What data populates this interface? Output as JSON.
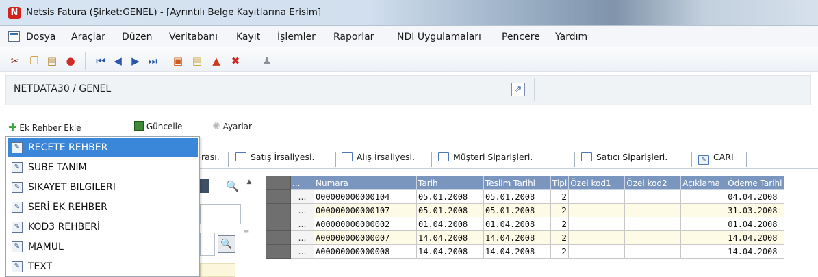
{
  "window": {
    "title": "Netsis Fatura (Şirket:GENEL) - [Ayrıntılı Belge Kayıtlarına Erisim]",
    "logo_letter": "N"
  },
  "menu": {
    "items": [
      "Dosya",
      "Araçlar",
      "Düzen",
      "Veritabanı",
      "Kayıt",
      "İşlemler",
      "Raporlar",
      "NDI Uygulamaları",
      "Pencere",
      "Yardım"
    ]
  },
  "toolbar": {
    "icons": [
      "cut-icon",
      "copy-icon",
      "paste-icon",
      "delete-icon",
      "first-record-icon",
      "prev-record-icon",
      "next-record-icon",
      "last-record-icon",
      "add-record-icon",
      "edit-record-icon",
      "refresh-record-icon",
      "remove-record-icon",
      "user-icon"
    ]
  },
  "path": {
    "text": "NETDATA30 / GENEL"
  },
  "toolbar2": {
    "add_label": "Ek Rehber Ekle",
    "update_label": "Güncelle",
    "settings_label": "Ayarlar"
  },
  "dropdown": {
    "items": [
      "RECETE REHBER",
      "SUBE TANIM",
      "SIKAYET BILGILERI",
      "SERİ EK REHBER",
      "KOD3 REHBERİ",
      "MAMUL",
      "TEXT"
    ],
    "selected_index": 0
  },
  "tabs": {
    "partial_label": "rası.",
    "items": [
      "Satış İrsaliyesi.",
      "Alış İrsaliyesi.",
      "Müşteri Siparişleri.",
      "Satıcı Siparişleri.",
      "CARI"
    ]
  },
  "grid": {
    "columns": [
      "...",
      "Numara",
      "Tarih",
      "Teslim Tarihi",
      "Tipi",
      "Özel kod1",
      "Özel kod2",
      "Açıklama",
      "Ödeme Tarihi"
    ],
    "rows": [
      {
        "dots": "...",
        "numara": "000000000000104",
        "tarih": "05.01.2008",
        "teslim": "05.01.2008",
        "tipi": "2",
        "ozel1": "",
        "ozel2": "",
        "aciklama": "",
        "odeme": "04.04.2008"
      },
      {
        "dots": "...",
        "numara": "000000000000107",
        "tarih": "05.01.2008",
        "teslim": "05.01.2008",
        "tipi": "2",
        "ozel1": "",
        "ozel2": "",
        "aciklama": "",
        "odeme": "31.03.2008"
      },
      {
        "dots": "...",
        "numara": "A00000000000002",
        "tarih": "01.04.2008",
        "teslim": "01.04.2008",
        "tipi": "2",
        "ozel1": "",
        "ozel2": "",
        "aciklama": "",
        "odeme": "01.04.2008"
      },
      {
        "dots": "...",
        "numara": "A00000000000007",
        "tarih": "14.04.2008",
        "teslim": "14.04.2008",
        "tipi": "2",
        "ozel1": "",
        "ozel2": "",
        "aciklama": "",
        "odeme": "14.04.2008"
      },
      {
        "dots": "...",
        "numara": "A00000000000008",
        "tarih": "14.04.2008",
        "teslim": "14.04.2008",
        "tipi": "2",
        "ozel1": "",
        "ozel2": "",
        "aciklama": "",
        "odeme": "14.04.2008"
      }
    ]
  },
  "colors": {
    "header_bg": "#7a96bf",
    "selection": "#3a86d8",
    "row_tint": "#fdfbe6",
    "logo": "#d2231e"
  }
}
